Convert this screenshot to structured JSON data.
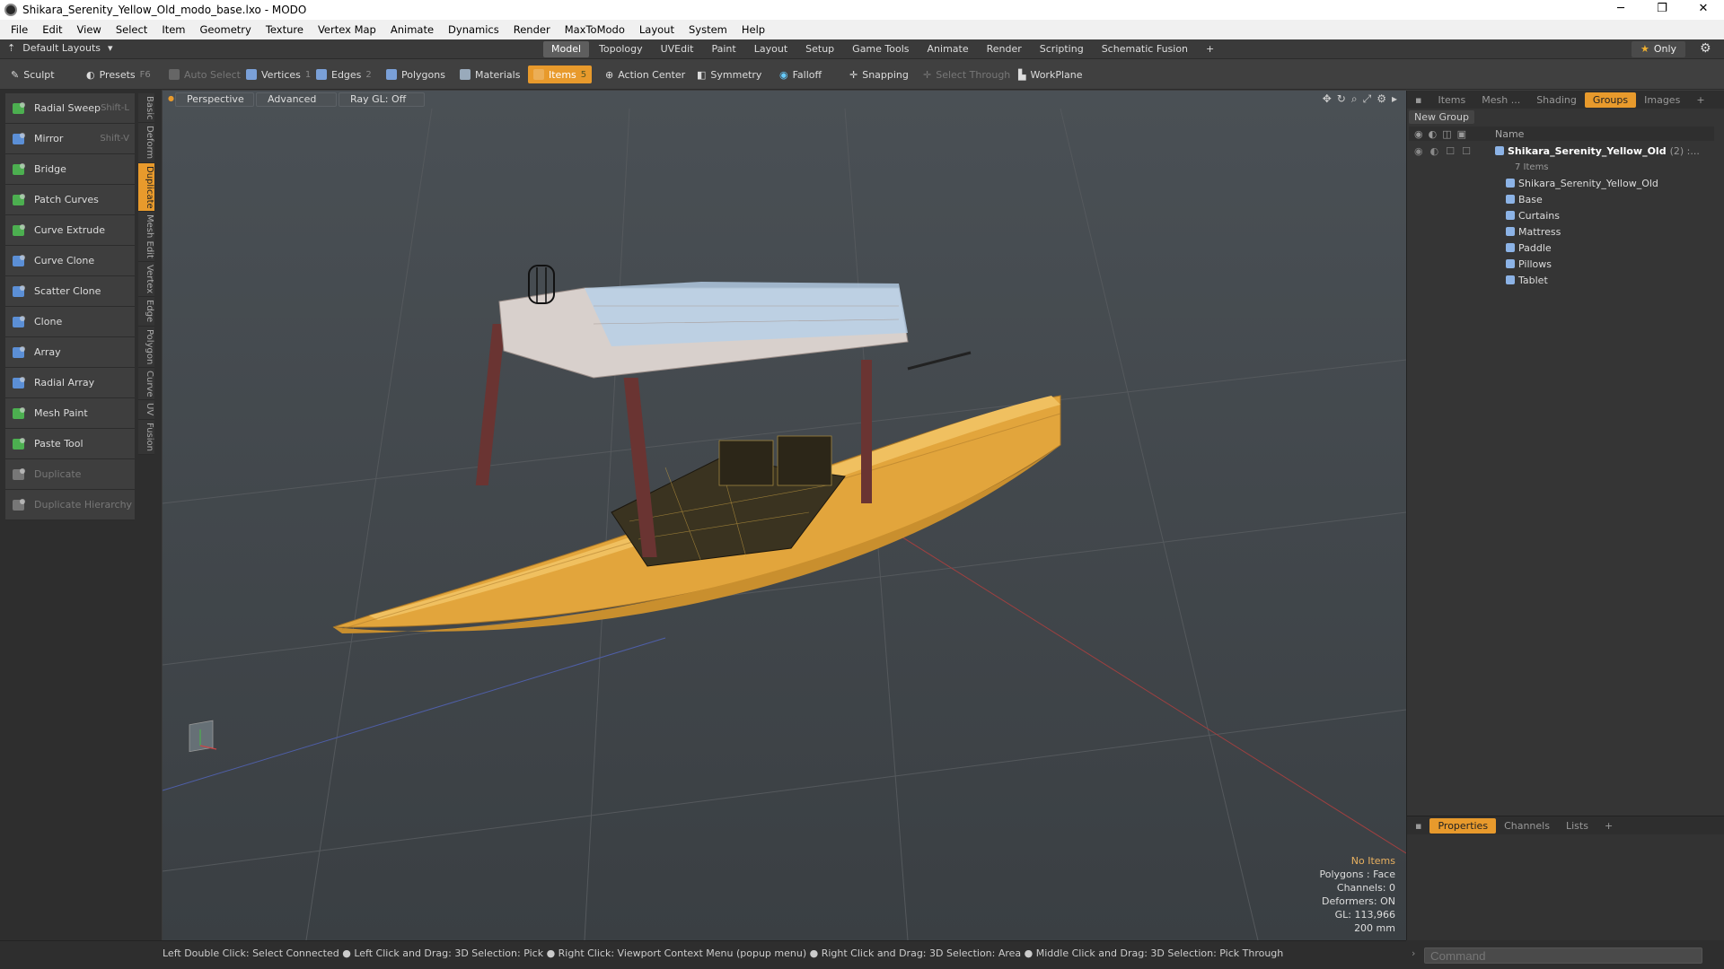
{
  "window": {
    "title": "Shikara_Serenity_Yellow_Old_modo_base.lxo - MODO",
    "minimize": "─",
    "maximize": "❐",
    "close": "✕"
  },
  "menu": [
    "File",
    "Edit",
    "View",
    "Select",
    "Item",
    "Geometry",
    "Texture",
    "Vertex Map",
    "Animate",
    "Dynamics",
    "Render",
    "MaxToModo",
    "Layout",
    "System",
    "Help"
  ],
  "layoutbar": {
    "layouts_label": "Default Layouts",
    "tabs": [
      "Model",
      "Topology",
      "UVEdit",
      "Paint",
      "Layout",
      "Setup",
      "Game Tools",
      "Animate",
      "Render",
      "Scripting",
      "Schematic Fusion"
    ],
    "active_tab": "Model",
    "add": "+",
    "only_label": "Only"
  },
  "toolbar": {
    "sculpt": "Sculpt",
    "presets": "Presets",
    "presets_shortcut": "F6",
    "auto_select": "Auto Select",
    "vertices": "Vertices",
    "vertices_count": "1",
    "edges": "Edges",
    "edges_count": "2",
    "polygons": "Polygons",
    "materials": "Materials",
    "items": "Items",
    "items_count": "5",
    "action_center": "Action Center",
    "symmetry": "Symmetry",
    "falloff": "Falloff",
    "snapping": "Snapping",
    "select_through": "Select Through",
    "workplane": "WorkPlane"
  },
  "tools": [
    {
      "label": "Radial Sweep",
      "shortcut": "Shift-L",
      "icon": "radial-sweep-icon",
      "color": "#4caf50"
    },
    {
      "label": "Mirror",
      "shortcut": "Shift-V",
      "icon": "mirror-icon",
      "color": "#5b8fd6"
    },
    {
      "label": "Bridge",
      "shortcut": "",
      "icon": "bridge-icon",
      "color": "#4caf50"
    },
    {
      "label": "Patch Curves",
      "shortcut": "",
      "icon": "patch-curves-icon",
      "color": "#4caf50"
    },
    {
      "label": "Curve Extrude",
      "shortcut": "",
      "icon": "curve-extrude-icon",
      "color": "#4caf50"
    },
    {
      "label": "Curve Clone",
      "shortcut": "",
      "icon": "curve-clone-icon",
      "color": "#5b8fd6"
    },
    {
      "label": "Scatter Clone",
      "shortcut": "",
      "icon": "scatter-clone-icon",
      "color": "#5b8fd6"
    },
    {
      "label": "Clone",
      "shortcut": "",
      "icon": "clone-icon",
      "color": "#5b8fd6"
    },
    {
      "label": "Array",
      "shortcut": "",
      "icon": "array-icon",
      "color": "#5b8fd6"
    },
    {
      "label": "Radial Array",
      "shortcut": "",
      "icon": "radial-array-icon",
      "color": "#5b8fd6"
    },
    {
      "label": "Mesh Paint",
      "shortcut": "",
      "icon": "mesh-paint-icon",
      "color": "#4caf50"
    },
    {
      "label": "Paste Tool",
      "shortcut": "",
      "icon": "paste-tool-icon",
      "color": "#4caf50"
    },
    {
      "label": "Duplicate",
      "shortcut": "",
      "icon": "duplicate-icon",
      "color": "#777777"
    },
    {
      "label": "Duplicate Hierarchy",
      "shortcut": "",
      "icon": "duplicate-hierarchy-icon",
      "color": "#777777"
    }
  ],
  "vertical_tabs": [
    "Basic",
    "Deform",
    "Duplicate",
    "Mesh Edit",
    "Vertex",
    "Edge",
    "Polygon",
    "Curve",
    "UV",
    "Fusion"
  ],
  "active_vertical_tab": "Duplicate",
  "viewport": {
    "perspective": "Perspective",
    "advanced": "Advanced",
    "raygl": "Ray GL: Off",
    "info": {
      "no_items": "No Items",
      "polygons": "Polygons : Face",
      "channels": "Channels: 0",
      "deformers": "Deformers: ON",
      "gl": "GL: 113,966",
      "scale": "200 mm"
    }
  },
  "rightpanel": {
    "tabs": [
      "Items",
      "Mesh ...",
      "Shading",
      "Groups",
      "Images"
    ],
    "active_tab": "Groups",
    "add_tab": "+",
    "new_group": "New Group",
    "name_header": "Name",
    "root": {
      "label": "Shikara_Serenity_Yellow_Old",
      "count": "(2) :..."
    },
    "sub_info": "7 Items",
    "children": [
      "Shikara_Serenity_Yellow_Old",
      "Base",
      "Curtains",
      "Mattress",
      "Paddle",
      "Pillows",
      "Tablet"
    ],
    "bottom_tabs": [
      "Properties",
      "Channels",
      "Lists"
    ],
    "bottom_active": "Properties"
  },
  "statusbar": {
    "text": "Left Double Click: Select Connected ● Left Click and Drag: 3D Selection: Pick ● Right Click: Viewport Context Menu (popup menu) ● Right Click and Drag: 3D Selection: Area ● Middle Click and Drag: 3D Selection: Pick Through"
  },
  "command": {
    "placeholder": "Command"
  }
}
